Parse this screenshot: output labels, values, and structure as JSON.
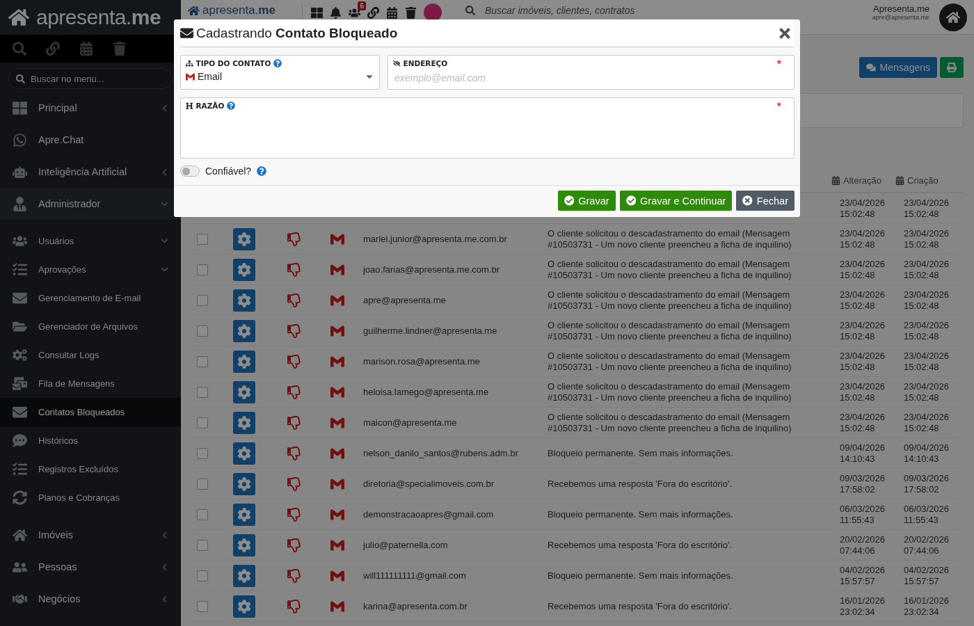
{
  "sidebar": {
    "logo": "apresenta.**me**",
    "search_placeholder": "Buscar no menu...",
    "items": [
      {
        "label": "Principal",
        "expanded": false,
        "selected": false
      },
      {
        "label": "Apre.Chat",
        "selected": false
      },
      {
        "label": "Inteligência Artificial",
        "expanded": false,
        "selected": false
      },
      {
        "label": "Administrador",
        "expanded": true,
        "selected": false,
        "children": [
          {
            "label": "Usuários",
            "expanded": false,
            "selected": false
          },
          {
            "label": "Aprovações",
            "expanded": false,
            "selected": false
          },
          {
            "label": "Gerenciamento de E-mail",
            "selected": false
          },
          {
            "label": "Gerenciador de Arquivos",
            "selected": false
          },
          {
            "label": "Consultar Logs",
            "selected": false
          },
          {
            "label": "Fila de Mensagens",
            "selected": false
          },
          {
            "label": "Contatos Bloqueados",
            "selected": true
          },
          {
            "label": "Históricos",
            "selected": false
          },
          {
            "label": "Registros Excluídos",
            "selected": false
          },
          {
            "label": "Planos e Cobranças",
            "selected": false
          }
        ]
      },
      {
        "label": "Imóveis",
        "expanded": false,
        "selected": false
      },
      {
        "label": "Pessoas",
        "expanded": false,
        "selected": false
      },
      {
        "label": "Negócios",
        "expanded": false,
        "selected": false
      }
    ]
  },
  "topbar": {
    "logo": "apresenta.**me**",
    "notification_badge": "6",
    "search_placeholder": "Buscar imóveis, clientes, contratos",
    "user_name": "Apresenta.me",
    "user_email": "apre@apresenta.me"
  },
  "actions": [
    {
      "kind": "messages",
      "label": "Mensagens"
    },
    {
      "kind": "print"
    }
  ],
  "table": {
    "columns": [
      {
        "label": "Alteração"
      },
      {
        "label": "Criação"
      }
    ],
    "rows": [
      {
        "altered": "23/04/2026 15:02:48",
        "created": "23/04/2026 15:02:48"
      },
      {
        "checked": false,
        "email": "marlei.junior@apresenta.me.com.br",
        "reason": "O cliente solicitou o descadastramento do email (Mensagem #10503731 - Um novo cliente preencheu a ficha de inquilino)",
        "altered": "23/04/2026 15:02:48",
        "created": "23/04/2026 15:02:48"
      },
      {
        "checked": false,
        "email": "joao.farias@apresenta.me.com.br",
        "reason": "O cliente solicitou o descadastramento do email (Mensagem #10503731 - Um novo cliente preencheu a ficha de inquilino)",
        "altered": "23/04/2026 15:02:48",
        "created": "23/04/2026 15:02:48"
      },
      {
        "checked": false,
        "email": "apre@apresenta.me",
        "reason": "O cliente solicitou o descadastramento do email (Mensagem #10503731 - Um novo cliente preencheu a ficha de inquilino)",
        "altered": "23/04/2026 15:02:48",
        "created": "23/04/2026 15:02:48"
      },
      {
        "checked": false,
        "email": "guilherme.lindner@apresenta.me",
        "reason": "O cliente solicitou o descadastramento do email (Mensagem #10503731 - Um novo cliente preencheu a ficha de inquilino)",
        "altered": "23/04/2026 15:02:48",
        "created": "23/04/2026 15:02:48"
      },
      {
        "checked": false,
        "email": "marison.rosa@apresenta.me",
        "reason": "O cliente solicitou o descadastramento do email (Mensagem #10503731 - Um novo cliente preencheu a ficha de inquilino)",
        "altered": "23/04/2026 15:02:48",
        "created": "23/04/2026 15:02:48"
      },
      {
        "checked": false,
        "email": "heloisa.lamego@apresenta.me",
        "reason": "O cliente solicitou o descadastramento do email (Mensagem #10503731 - Um novo cliente preencheu a ficha de inquilino)",
        "altered": "23/04/2026 15:02:48",
        "created": "23/04/2026 15:02:48"
      },
      {
        "checked": false,
        "email": "maicon@apresenta.me",
        "reason": "O cliente solicitou o descadastramento do email (Mensagem #10503731 - Um novo cliente preencheu a ficha de inquilino)",
        "altered": "23/04/2026 15:02:48",
        "created": "23/04/2026 15:02:48"
      },
      {
        "checked": false,
        "email": "nelson_danilo_santos@rubens.adm.br",
        "reason": "Bloqueio permanente. Sem mais informações.",
        "altered": "09/04/2026 14:10:43",
        "created": "09/04/2026 14:10:43"
      },
      {
        "checked": false,
        "email": "diretoria@specialimoveis.com.br",
        "reason": "Recebemos uma resposta 'Fora do escritório'.",
        "altered": "09/03/2026 17:58:02",
        "created": "09/03/2026 17:58:02"
      },
      {
        "checked": false,
        "email": "demonstracaoapres@gmail.com",
        "reason": "Bloqueio permanente. Sem mais informações.",
        "altered": "06/03/2026 11:55:43",
        "created": "06/03/2026 11:55:43"
      },
      {
        "checked": false,
        "email": "julio@paternella.com",
        "reason": "Recebemos uma resposta 'Fora do escritório'.",
        "altered": "20/02/2026 07:44:06",
        "created": "20/02/2026 07:44:06"
      },
      {
        "checked": false,
        "email": "will111111111@gmail.com",
        "reason": "Bloqueio permanente. Sem mais informações.",
        "altered": "04/02/2026 15:57:57",
        "created": "04/02/2026 15:57:57"
      },
      {
        "checked": false,
        "email": "karina@apresenta.com.br",
        "reason": "Recebemos uma resposta 'Fora do escritório'.",
        "altered": "16/01/2026 23:02:34",
        "created": "16/01/2026 23:02:34"
      }
    ]
  },
  "modal": {
    "title": "Cadastrando **Contato Bloqueado**",
    "fields": [
      {
        "kind": "select",
        "label": "TIPO DO CONTATO",
        "help": true,
        "value": "Email"
      },
      {
        "kind": "input",
        "label": "ENDEREÇO",
        "help": false,
        "required_mark": "*",
        "placeholder": "exemplo@email.com"
      },
      {
        "kind": "textarea",
        "label": "RAZÃO",
        "help": true,
        "required_mark": "*"
      }
    ],
    "toggle": {
      "label": "Confiável?",
      "on": false,
      "help": true
    },
    "buttons": [
      {
        "kind": "success",
        "label": "Gravar"
      },
      {
        "kind": "success",
        "label": "Gravar e Continuar"
      },
      {
        "kind": "close",
        "label": "Fechar"
      }
    ]
  }
}
